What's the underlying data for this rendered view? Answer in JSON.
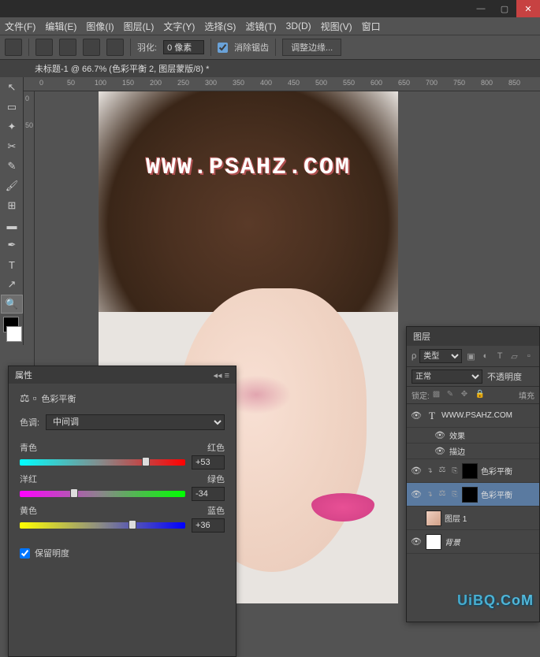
{
  "menubar": {
    "file": "文件(F)",
    "edit": "编辑(E)",
    "image": "图像(I)",
    "layer": "图层(L)",
    "type": "文字(Y)",
    "select": "选择(S)",
    "filter": "滤镜(T)",
    "threed": "3D(D)",
    "view": "视图(V)",
    "window": "窗口"
  },
  "optbar": {
    "feather_label": "羽化:",
    "feather_value": "0 像素",
    "antialias_label": "消除锯齿",
    "refine_edge": "调整边缘..."
  },
  "doc_tab": "未标题-1 @ 66.7% (色彩平衡 2, 图层蒙版/8) *",
  "ruler_h": [
    "0",
    "50",
    "100",
    "150",
    "200",
    "250",
    "300",
    "350",
    "400",
    "450",
    "500",
    "550",
    "600",
    "650",
    "700",
    "750",
    "800",
    "850"
  ],
  "ruler_v": [
    "0",
    "50"
  ],
  "canvas": {
    "watermark": "WWW.PSAHZ.COM"
  },
  "properties": {
    "panel_title": "属性",
    "section_title": "色彩平衡",
    "tone_label": "色调:",
    "tone_value": "中间调",
    "sliders": {
      "s1": {
        "left": "青色",
        "right": "红色",
        "value": "+53",
        "pos": 76
      },
      "s2": {
        "left": "洋红",
        "right": "绿色",
        "value": "-34",
        "pos": 33
      },
      "s3": {
        "left": "黄色",
        "right": "蓝色",
        "value": "+36",
        "pos": 68
      }
    },
    "preserve_luminance": "保留明度"
  },
  "layers": {
    "panel_title": "图层",
    "type_filter": "类型",
    "blend_mode": "正常",
    "opacity_label": "不透明度",
    "lock_label": "锁定:",
    "fill_label": "填充",
    "items": {
      "text": {
        "name": "WWW.PSAHZ.COM"
      },
      "fx": {
        "label": "效果",
        "stroke": "描边"
      },
      "cb2": {
        "name": "色彩平衡"
      },
      "cb1": {
        "name": "色彩平衡"
      },
      "img": {
        "name": "图层 1"
      },
      "bg": {
        "name": "背景"
      }
    }
  },
  "corner_watermark": "UiBQ.CoM"
}
